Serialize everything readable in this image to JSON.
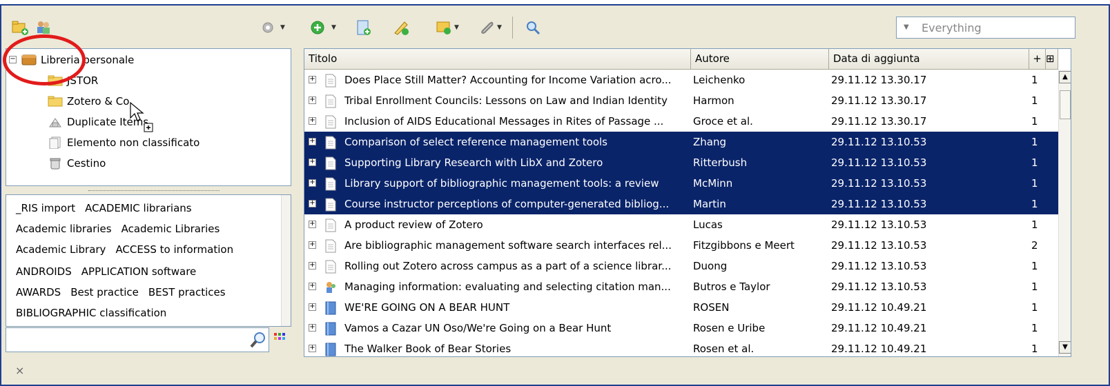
{
  "toolbar": {
    "icons": [
      "new-collection-icon",
      "new-group-icon",
      "actions-gear-icon",
      "add-by-identifier-icon",
      "new-item-icon",
      "add-note-icon",
      "add-attachment-icon",
      "paperclip-icon",
      "search-icon"
    ],
    "search_placeholder": "Everything"
  },
  "collections": {
    "root": "Libreria personale",
    "items": [
      "JSTOR",
      "Zotero & Co.",
      "Duplicate Items",
      "Elemento non classificato",
      "Cestino"
    ]
  },
  "tags": {
    "lines": [
      [
        "_RIS import",
        "ACADEMIC librarians"
      ],
      [
        "Academic libraries",
        "Academic Libraries"
      ],
      [
        "Academic Library",
        "ACCESS to information"
      ],
      [
        "ANDROIDS",
        "APPLICATION software"
      ],
      [
        "AWARDS",
        "Best practice",
        "BEST practices"
      ],
      [
        "BIBLIOGRAPHIC classification"
      ]
    ],
    "filter_value": ""
  },
  "items": {
    "columns": {
      "title": "Titolo",
      "author": "Autore",
      "date": "Data di aggiunta",
      "plus": "+"
    },
    "rows": [
      {
        "title": "Does Place Still Matter? Accounting for Income Variation acro...",
        "author": "Leichenko",
        "date": "29.11.12 13.30.17",
        "num": "1",
        "selected": false,
        "type": "document"
      },
      {
        "title": "Tribal Enrollment Councils: Lessons on Law and Indian Identity",
        "author": "Harmon",
        "date": "29.11.12 13.30.17",
        "num": "1",
        "selected": false,
        "type": "document"
      },
      {
        "title": "Inclusion of AIDS Educational Messages in Rites of Passage ...",
        "author": "Groce et al.",
        "date": "29.11.12 13.30.17",
        "num": "1",
        "selected": false,
        "type": "document"
      },
      {
        "title": "Comparison of select reference management tools",
        "author": "Zhang",
        "date": "29.11.12 13.10.53",
        "num": "1",
        "selected": true,
        "type": "document"
      },
      {
        "title": "Supporting Library Research with LibX and Zotero",
        "author": "Ritterbush",
        "date": "29.11.12 13.10.53",
        "num": "1",
        "selected": true,
        "type": "document"
      },
      {
        "title": "Library support of bibliographic management tools: a review",
        "author": "McMinn",
        "date": "29.11.12 13.10.53",
        "num": "1",
        "selected": true,
        "type": "document"
      },
      {
        "title": "Course instructor perceptions of computer-generated bibliog...",
        "author": "Martin",
        "date": "29.11.12 13.10.53",
        "num": "1",
        "selected": true,
        "type": "document"
      },
      {
        "title": "A product review of Zotero",
        "author": "Lucas",
        "date": "29.11.12 13.10.53",
        "num": "1",
        "selected": false,
        "type": "document"
      },
      {
        "title": "Are bibliographic management software search interfaces rel...",
        "author": "Fitzgibbons e Meert",
        "date": "29.11.12 13.10.53",
        "num": "2",
        "selected": false,
        "type": "document"
      },
      {
        "title": "Rolling out Zotero across campus as a part of a science librar...",
        "author": "Duong",
        "date": "29.11.12 13.10.53",
        "num": "1",
        "selected": false,
        "type": "document"
      },
      {
        "title": "Managing information: evaluating and selecting citation man...",
        "author": "Butros e Taylor",
        "date": "29.11.12 13.10.53",
        "num": "1",
        "selected": false,
        "type": "report"
      },
      {
        "title": "WE'RE GOING ON A BEAR HUNT",
        "author": "ROSEN",
        "date": "29.11.12 10.49.21",
        "num": "1",
        "selected": false,
        "type": "book"
      },
      {
        "title": "Vamos a Cazar UN Oso/We're Going on a Bear Hunt",
        "author": "Rosen e Uribe",
        "date": "29.11.12 10.49.21",
        "num": "1",
        "selected": false,
        "type": "book"
      },
      {
        "title": "The Walker Book of Bear Stories",
        "author": "Rosen et al.",
        "date": "29.11.12 10.49.21",
        "num": "1",
        "selected": false,
        "type": "book"
      }
    ]
  },
  "statusbar": {
    "close": "×"
  },
  "colors": {
    "selection": "#0a246a",
    "annotation": "#e21b1b",
    "border": "#1f3f8f"
  }
}
